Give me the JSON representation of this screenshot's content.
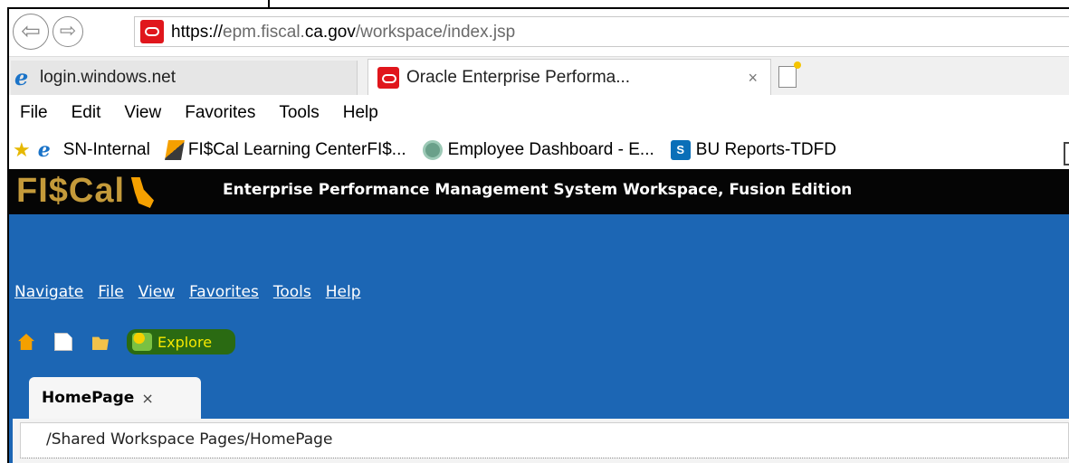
{
  "browser": {
    "url_host_prefix": "https://",
    "url_host_mid1": "epm.fiscal.",
    "url_host_bold": "ca.gov",
    "url_path": "/workspace/index.jsp",
    "tabs": [
      {
        "label": "login.windows.net",
        "icon": "ie-icon"
      },
      {
        "label": "Oracle Enterprise Performa...",
        "icon": "oracle-icon",
        "close": "×"
      }
    ],
    "menu": [
      "File",
      "Edit",
      "View",
      "Favorites",
      "Tools",
      "Help"
    ],
    "favorites": [
      {
        "label": "SN-Internal",
        "icon": "ie-icon"
      },
      {
        "label": "FI$Cal Learning CenterFI$...",
        "icon": "fiscal-icon"
      },
      {
        "label": "Employee Dashboard - E...",
        "icon": "employee-dashboard-icon"
      },
      {
        "label": "BU Reports-TDFD",
        "icon": "sharepoint-icon"
      }
    ]
  },
  "app": {
    "logo": "FI$Cal",
    "title": "Enterprise Performance Management System Workspace, Fusion Edition",
    "menu": [
      "Navigate",
      "File",
      "View",
      "Favorites",
      "Tools",
      "Help"
    ],
    "toolbar": {
      "explore_label": "Explore"
    },
    "page_tab": {
      "label": "HomePage",
      "close": "×"
    },
    "path": "/Shared Workspace Pages/HomePage"
  },
  "colors": {
    "app_blue": "#1c66b4",
    "header_black": "#050505",
    "explore_highlight": "#2a6a12",
    "explore_text": "#f5e800"
  }
}
